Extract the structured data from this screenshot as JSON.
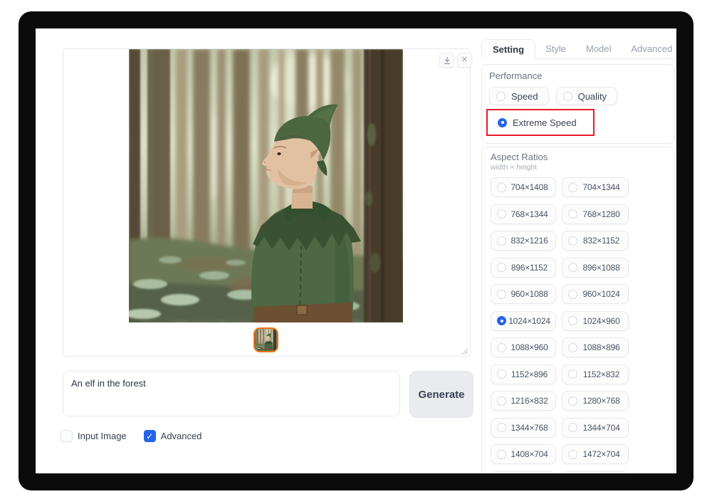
{
  "colors": {
    "accent_blue": "#2563eb",
    "highlight_red": "#e8192c",
    "thumbnail_orange": "#ee7311"
  },
  "tabs": [
    {
      "label": "Setting",
      "active": true
    },
    {
      "label": "Style",
      "active": false
    },
    {
      "label": "Model",
      "active": false
    },
    {
      "label": "Advanced",
      "active": false
    }
  ],
  "icons": {
    "close": "✕",
    "check": "✓",
    "download": "download-arrow",
    "resize": "diagonal-grip"
  },
  "panel": {
    "performance": {
      "title": "Performance",
      "options": [
        {
          "label": "Speed",
          "selected": false
        },
        {
          "label": "Quality",
          "selected": false
        },
        {
          "label": "Extreme Speed",
          "selected": true,
          "highlighted": true
        }
      ]
    },
    "aspect_ratios": {
      "title": "Aspect Ratios",
      "subtitle": "width × height",
      "selected": "1024×1024",
      "options": [
        {
          "label": "704×1408",
          "selected": false
        },
        {
          "label": "704×1344",
          "selected": false
        },
        {
          "label": "768×1344",
          "selected": false
        },
        {
          "label": "768×1280",
          "selected": false
        },
        {
          "label": "832×1216",
          "selected": false
        },
        {
          "label": "832×1152",
          "selected": false
        },
        {
          "label": "896×1152",
          "selected": false
        },
        {
          "label": "896×1088",
          "selected": false
        },
        {
          "label": "960×1088",
          "selected": false
        },
        {
          "label": "960×1024",
          "selected": false
        },
        {
          "label": "1024×1024",
          "selected": true
        },
        {
          "label": "1024×960",
          "selected": false
        },
        {
          "label": "1088×960",
          "selected": false
        },
        {
          "label": "1088×896",
          "selected": false
        },
        {
          "label": "1152×896",
          "selected": false
        },
        {
          "label": "1152×832",
          "selected": false
        },
        {
          "label": "1216×832",
          "selected": false
        },
        {
          "label": "1280×768",
          "selected": false
        },
        {
          "label": "1344×768",
          "selected": false
        },
        {
          "label": "1344×704",
          "selected": false
        },
        {
          "label": "1408×704",
          "selected": false
        },
        {
          "label": "1472×704",
          "selected": false
        }
      ]
    }
  },
  "prompt": {
    "value": "An elf in the forest"
  },
  "generate": {
    "label": "Generate"
  },
  "options_row": [
    {
      "label": "Input Image",
      "checked": false
    },
    {
      "label": "Advanced",
      "checked": true
    }
  ]
}
